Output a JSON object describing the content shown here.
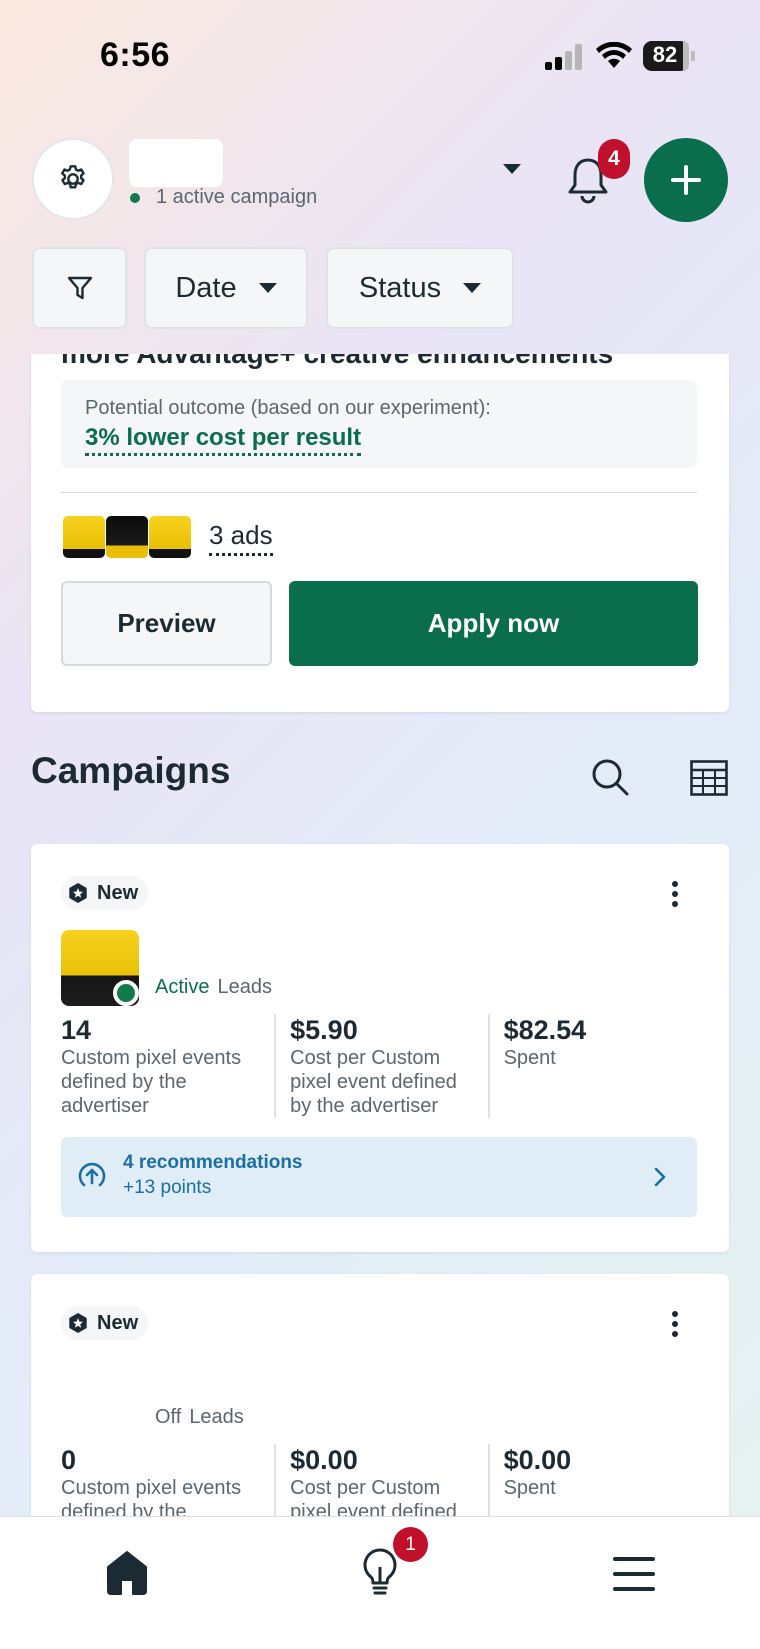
{
  "status_bar": {
    "time": "6:56",
    "battery": "82"
  },
  "header": {
    "account_status": "1 active campaign",
    "notification_count": "4"
  },
  "filters": {
    "date_label": "Date",
    "status_label": "Status"
  },
  "recommendation_card": {
    "title": "more Advantage+ creative enhancements",
    "outcome_label": "Potential outcome (based on our experiment):",
    "outcome_value": "3% lower cost per result",
    "ads_count": "3 ads",
    "preview_label": "Preview",
    "apply_label": "Apply now"
  },
  "campaigns": {
    "section_title": "Campaigns",
    "items": [
      {
        "badge": "New",
        "status": "Active",
        "objective": "Leads",
        "metrics": [
          {
            "value": "14",
            "label": "Custom pixel events defined by the advertiser"
          },
          {
            "value": "$5.90",
            "label": "Cost per Custom pixel event defined by the advertiser"
          },
          {
            "value": "$82.54",
            "label": "Spent"
          }
        ],
        "recommendations": {
          "title": "4 recommendations",
          "points": "+13 points"
        }
      },
      {
        "badge": "New",
        "status": "Off",
        "objective": "Leads",
        "metrics": [
          {
            "value": "0",
            "label": "Custom pixel events defined by the advertiser"
          },
          {
            "value": "$0.00",
            "label": "Cost per Custom pixel event defined by the advertiser"
          },
          {
            "value": "$0.00",
            "label": "Spent"
          }
        ]
      }
    ]
  },
  "bottom_nav": {
    "insights_badge": "1"
  },
  "colors": {
    "brand_green": "#0a6e4c",
    "badge_red": "#c0102b",
    "reco_blue": "#1a6fa3"
  },
  "icons": [
    "gear-icon",
    "chevron-down-icon",
    "bell-icon",
    "plus-icon",
    "filter-icon",
    "search-icon",
    "table-icon",
    "more-icon",
    "arrow-up-circle-icon",
    "chevron-right-icon",
    "home-icon",
    "lightbulb-icon",
    "menu-icon"
  ]
}
